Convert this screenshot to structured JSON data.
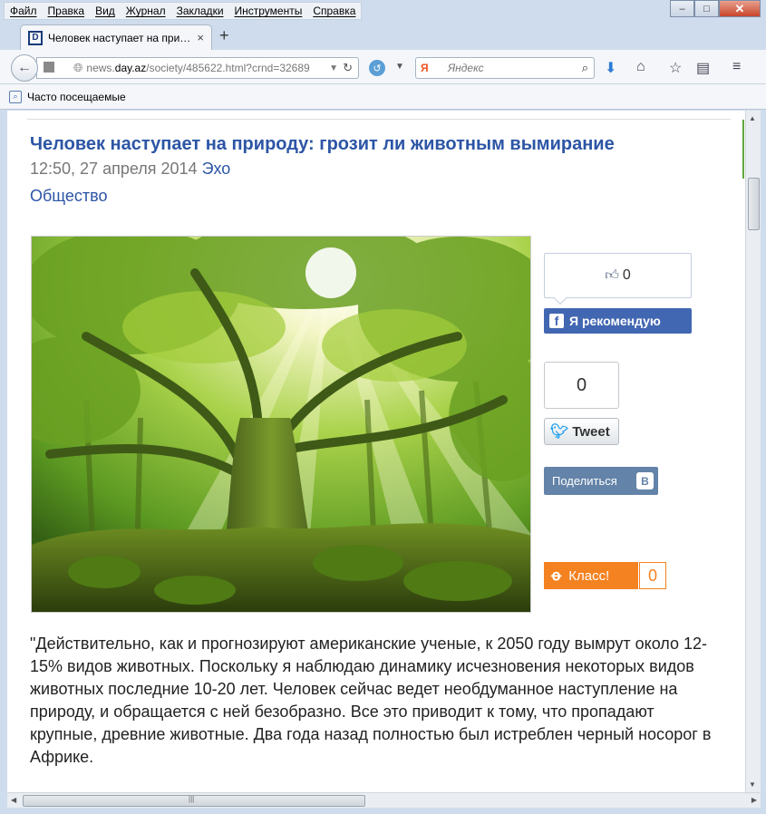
{
  "menu": [
    "Файл",
    "Правка",
    "Вид",
    "Журнал",
    "Закладки",
    "Инструменты",
    "Справка"
  ],
  "window_controls": {
    "minimize": "–",
    "maximize": "□",
    "close": "✕"
  },
  "tab": {
    "favicon": "D",
    "title": "Человек наступает на при…",
    "close": "×"
  },
  "new_tab": "+",
  "url": {
    "prefix": "news.",
    "domain": "day.az",
    "path": "/society/485622.html?crnd=32689"
  },
  "search": {
    "placeholder": "Яндекс",
    "engine_logo": "Я"
  },
  "bookmarks": {
    "item": "Часто посещаемые"
  },
  "article": {
    "headline": "Человек наступает на природу: грозит ли животным вымирание",
    "datetime": "12:50, 27 апреля 2014",
    "source": "Эхо",
    "category": "Общество",
    "paragraph": "\"Действительно, как и прогнозируют американские ученые, к 2050 году вымрут около 12-15% видов животных. Поскольку я наблюдаю динамику исчезновения некоторых видов животных последние 10-20 лет. Человек сейчас ведет необдуманное наступление на природу, и обращается с ней безобразно. Все это приводит к тому, что пропадают крупные, древние животные. Два года назад полностью был истреблен черный носорог в Африке."
  },
  "social": {
    "fb_like_count": "0",
    "fb_button": "Я рекомендую",
    "tweet_count": "0",
    "tweet_button": "Tweet",
    "vk_button": "Поделиться",
    "vk_logo": "B",
    "ok_button": "Класс!",
    "ok_count": "0"
  },
  "icons": [
    "back-arrow-icon",
    "globe-icon",
    "reload-icon",
    "search-icon",
    "download-icon",
    "home-icon",
    "bookmark-star-icon",
    "clipboard-icon",
    "menu-icon"
  ],
  "colors": {
    "link": "#2c55a5",
    "facebook": "#4267b2",
    "vk": "#6383a8",
    "ok": "#f48220",
    "twitter": "#2aa3ef"
  }
}
